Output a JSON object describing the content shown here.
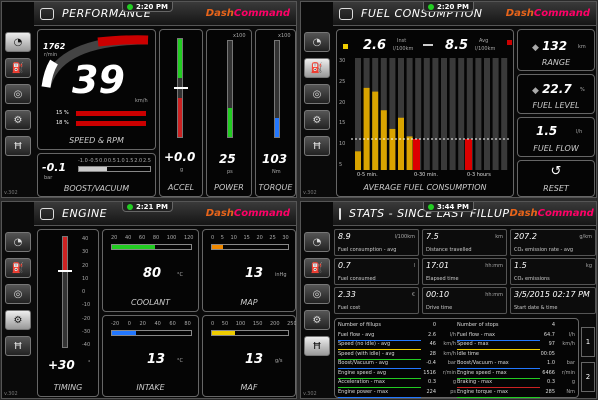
{
  "q1": {
    "time": "2:20 PM",
    "title": "PERFORMANCE",
    "logo_a": "Dash",
    "logo_b": "Command",
    "rpm": "1762",
    "rpm_unit": "r/min",
    "speed": "39",
    "speed_unit": "km/h",
    "pct1_label": "15",
    "pct1_unit": "%",
    "pct2_label": "18",
    "pct2_unit": "%",
    "speed_label": "SPEED & RPM",
    "boost": "-0.1",
    "boost_unit": "bar",
    "boost_label": "BOOST/VACUUM",
    "boost_ticks": [
      "-1.0",
      "-0.5",
      "0.0",
      "0.5",
      "1.0",
      "1.5",
      "2.0",
      "2.5"
    ],
    "accel": "+0.0",
    "accel_unit": "g",
    "accel_label": "ACCEL",
    "power": "25",
    "power_unit": "ps",
    "power_label": "POWER",
    "power_scale": "x100",
    "torque": "103",
    "torque_unit": "Nm",
    "torque_label": "TORQUE",
    "torque_scale": "x100"
  },
  "q2": {
    "time": "2:20 PM",
    "title": "FUEL CONSUMPTION",
    "inst": "2.6",
    "inst_lbl": "Inst",
    "inst_unit": "l/100km",
    "avg": "8.5",
    "avg_lbl": "Avg",
    "avg_unit": "l/100km",
    "range": "132",
    "range_unit": "km",
    "range_label": "RANGE",
    "level": "22.7",
    "level_unit": "%",
    "level_label": "FUEL LEVEL",
    "flow": "1.5",
    "flow_unit": "l/h",
    "flow_label": "FUEL FLOW",
    "reset_label": "RESET",
    "avg_label": "AVERAGE FUEL CONSUMPTION",
    "t1": "0-5 min.",
    "t2": "0-30 min.",
    "t3": "0-3 hours",
    "yt": [
      "30",
      "25",
      "20",
      "15",
      "10",
      "5"
    ]
  },
  "q3": {
    "time": "2:21 PM",
    "title": "ENGINE",
    "timing": "+30",
    "timing_unit": "°",
    "timing_label": "TIMING",
    "coolant": "80",
    "coolant_unit": "°C",
    "coolant_label": "COOLANT",
    "coolant_ticks": "20 40 60 80 100 120",
    "map": "13",
    "map_unit": "inHg",
    "map_label": "MAP",
    "map_ticks": "0 5 10 15 20 25 30",
    "intake": "13",
    "intake_unit": "°C",
    "intake_label": "INTAKE",
    "intake_ticks": "-20 0 20 40 60 80",
    "maf": "13",
    "maf_unit": "g/s",
    "maf_label": "MAF",
    "maf_ticks": "0 50 100 150 200 250",
    "timing_ticks": [
      "40",
      "30",
      "20",
      "10",
      "0",
      "-10",
      "-20",
      "-30",
      "-40"
    ]
  },
  "q4": {
    "time": "3:44 PM",
    "title": "STATS - SINCE LAST FILLUP",
    "cells": [
      {
        "v": "8.9",
        "u": "l/100km",
        "l": "Fuel consumption - avg"
      },
      {
        "v": "7.5",
        "u": "km",
        "l": "Distance travelled"
      },
      {
        "v": "207.2",
        "u": "g/km",
        "l": "CO₂ emission rate - avg"
      },
      {
        "v": "0.7",
        "u": "l",
        "l": "Fuel consumed"
      },
      {
        "v": "17:01",
        "u": "hh:mm",
        "l": "Elapsed time"
      },
      {
        "v": "1.5",
        "u": "kg",
        "l": "CO₂ emissions"
      },
      {
        "v": "2.33",
        "u": "€",
        "l": "Fuel cost"
      },
      {
        "v": "00:10",
        "u": "hh:mm",
        "l": "Drive time"
      },
      {
        "v": "3/5/2015 02:17 PM",
        "u": "",
        "l": "Start date & time"
      }
    ],
    "rows_l": [
      [
        "Number of fillups",
        "0",
        ""
      ],
      [
        "Fuel flow - avg",
        "2.6",
        "l/h"
      ],
      [
        "Speed (no idle) - avg",
        "46",
        "km/h"
      ],
      [
        "Speed (with idle) - avg",
        "28",
        "km/h"
      ],
      [
        "Boost/Vacuum - avg",
        "-0.4",
        "bar"
      ],
      [
        "Engine speed - avg",
        "1516",
        "r/min"
      ],
      [
        "Acceleration - max",
        "0.3",
        "g"
      ],
      [
        "Engine power - max",
        "224",
        "ps"
      ]
    ],
    "rows_r": [
      [
        "Number of stops",
        "4",
        ""
      ],
      [
        "Fuel flow - max",
        "64.7",
        "l/h"
      ],
      [
        "Speed - max",
        "97",
        "km/h"
      ],
      [
        "Idle time",
        "00:05",
        ""
      ],
      [
        "Boost/Vacuum - max",
        "1.0",
        "bar"
      ],
      [
        "Engine speed - max",
        "6466",
        "r/min"
      ],
      [
        "Braking - max",
        "0.3",
        "g"
      ],
      [
        "Engine torque - max",
        "285",
        "Nm"
      ]
    ],
    "page1": "1",
    "page2": "2"
  }
}
